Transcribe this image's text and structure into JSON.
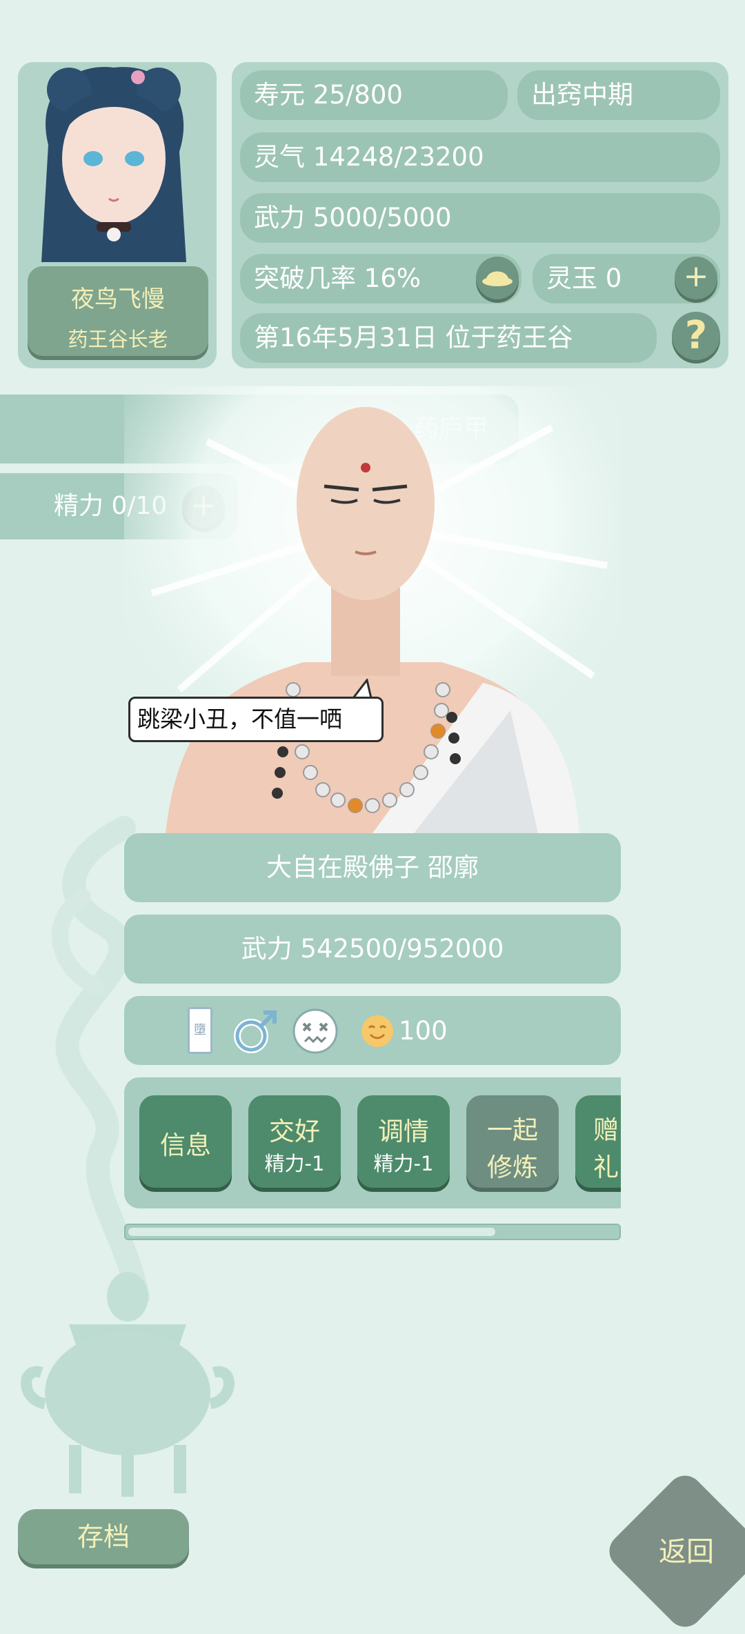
{
  "player": {
    "name": "夜鸟飞慢",
    "title": "药王谷长老"
  },
  "stats": {
    "lifespan": "寿元 25/800",
    "realm": "出窍中期",
    "qi": "灵气 14248/23200",
    "power": "武力 5000/5000",
    "breakthrough": "突破几率 16%",
    "jade": "灵玉 0",
    "date_location": "第16年5月31日 位于药王谷",
    "help_symbol": "?",
    "plus_symbol": "+"
  },
  "npc_panel": {
    "tab_name": "药庐甲",
    "energy": "精力 0/10",
    "speech": "跳梁小丑，不值一哂",
    "identity": "大自在殿佛子 邵廓",
    "power": "武力 542500/952000",
    "favor_value": "100",
    "card_icon_text": "墮"
  },
  "actions": [
    {
      "label": "信息",
      "sub": ""
    },
    {
      "label": "交好",
      "sub": "精力-1"
    },
    {
      "label": "调情",
      "sub": "精力-1"
    },
    {
      "label": "一起",
      "label2": "修炼"
    },
    {
      "label": "赠",
      "label2": "礼"
    }
  ],
  "bottom": {
    "save": "存档",
    "back": "返回"
  },
  "colors": {
    "background": "#e2f1ec",
    "panel": "#a6cdbf",
    "button_green": "#4d8b6c",
    "button_text": "#f3f0b8"
  }
}
